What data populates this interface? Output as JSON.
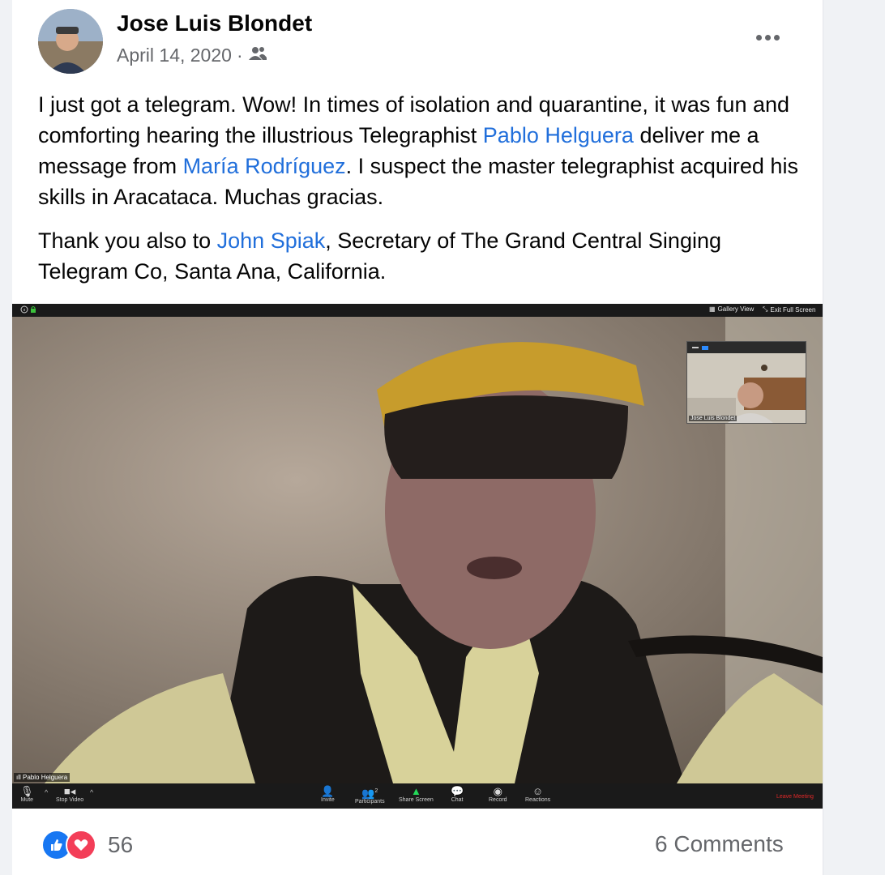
{
  "post": {
    "author": "Jose Luis Blondet",
    "date": "April 14, 2020",
    "separator": "·",
    "audience_icon": "friends-icon",
    "more_icon": "more-horizontal-icon",
    "paragraph1": {
      "t1": "I just got a telegram. Wow! In times of isolation and quarantine, it was fun and comforting hearing the illustrious Telegraphist ",
      "link1": "Pablo Helguera",
      "t2": " deliver me a message from ",
      "link2": "María Rodríguez",
      "t3": ".  I suspect the master telegraphist acquired his skills in Aracataca. Muchas gracias."
    },
    "paragraph2": {
      "t1": "Thank you also to ",
      "link1": "John Spiak",
      "t2": ", Secretary of The Grand Central Singing Telegram Co, Santa Ana, California."
    }
  },
  "video": {
    "gallery_view": "Gallery View",
    "exit_full_screen": "Exit Full Screen",
    "main_participant": "Pablo Helguera",
    "pip_participant": "Jose Luis Blondet",
    "toolbar": {
      "mute": "Mute",
      "stop_video": "Stop Video",
      "invite": "Invite",
      "participants": "Participants",
      "participants_count": "2",
      "share_screen": "Share Screen",
      "chat": "Chat",
      "record": "Record",
      "reactions": "Reactions",
      "leave_meeting": "Leave Meeting"
    }
  },
  "footer": {
    "reactions": [
      "like-icon",
      "love-icon"
    ],
    "reaction_count": "56",
    "comments": "6 Comments"
  },
  "colors": {
    "link": "#216fdb",
    "like": "#1877f2",
    "love": "#f33e58",
    "leave": "#e02828"
  }
}
